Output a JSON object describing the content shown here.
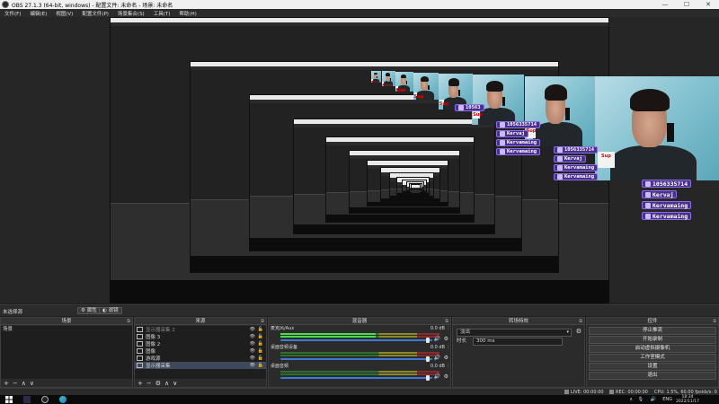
{
  "window": {
    "title": "OBS 27.1.3 (64-bit, windows) - 配置文件: 未命名 - 场景: 未命名",
    "minimize": "—",
    "maximize": "☐",
    "close": "✕"
  },
  "menubar": [
    "文件(F)",
    "编辑(E)",
    "视图(V)",
    "配置文件(P)",
    "场景集合(S)",
    "工具(T)",
    "帮助(H)"
  ],
  "overlay": {
    "lines": [
      {
        "icon": "qq-icon",
        "text": "1056335714"
      },
      {
        "icon": "tiktok-icon",
        "text": "Kervaj"
      },
      {
        "icon": "bilibili-icon",
        "text": "Kervamaing"
      },
      {
        "icon": "kuaishou-icon",
        "text": "Kervamaing"
      }
    ],
    "partial_qq": "10563"
  },
  "webcam": {
    "cup_text": "Sup"
  },
  "dock_header": {
    "scene_label": "未选择源",
    "properties_button": "属性",
    "filters_button": "滤镜"
  },
  "scenes": {
    "title": "场景",
    "items": [
      "场景"
    ],
    "footer": [
      "+",
      "−",
      "∧",
      "∨"
    ]
  },
  "sources": {
    "title": "来源",
    "items": [
      {
        "name": "显示器采集 2",
        "dim": true
      },
      {
        "name": "图像 3",
        "dim": false
      },
      {
        "name": "图像 2",
        "dim": false
      },
      {
        "name": "图像",
        "dim": false
      },
      {
        "name": "游戏源",
        "dim": false
      },
      {
        "name": "显示器采集",
        "dim": false,
        "selected": true
      }
    ],
    "footer": [
      "+",
      "−",
      "⚙",
      "∧",
      "∨"
    ]
  },
  "mixer": {
    "title": "混音器",
    "channels": [
      {
        "name": "麦克风/Aux",
        "db": "0.0 dB",
        "level": 0.6,
        "fader": 0.97
      },
      {
        "name": "桌面音频设备",
        "db": "0.0 dB",
        "level": 0.0,
        "fader": 0.97
      },
      {
        "name": "桌面音频",
        "db": "0.0 dB",
        "level": 0.0,
        "fader": 0.97
      }
    ]
  },
  "transitions": {
    "title": "转场特效",
    "type": "淡出",
    "duration_label": "时长",
    "duration": "300 ms"
  },
  "controls": {
    "title": "控件",
    "buttons": [
      "停止推流",
      "开始录制",
      "启动虚拟摄像机",
      "工作室模式",
      "设置",
      "退出"
    ]
  },
  "status": {
    "live_label": "LIVE:",
    "live_time": "00:00:00",
    "rec_label": "REC:",
    "rec_time": "00:00:00",
    "cpu": "CPU: 1.5%, 60.00 fps",
    "bitrate": "kb/s: 0"
  },
  "taskbar": {
    "lang": "ENG",
    "time": "18:34",
    "date": "2022/11/17",
    "tray_up": "∧",
    "tray_mic": "🎙",
    "tray_vol": "🔊"
  },
  "colors": {
    "accent_blue": "#3a7bd5",
    "overlay_purple": "#4a2f8f",
    "meter_green": "#4ddc4d"
  }
}
